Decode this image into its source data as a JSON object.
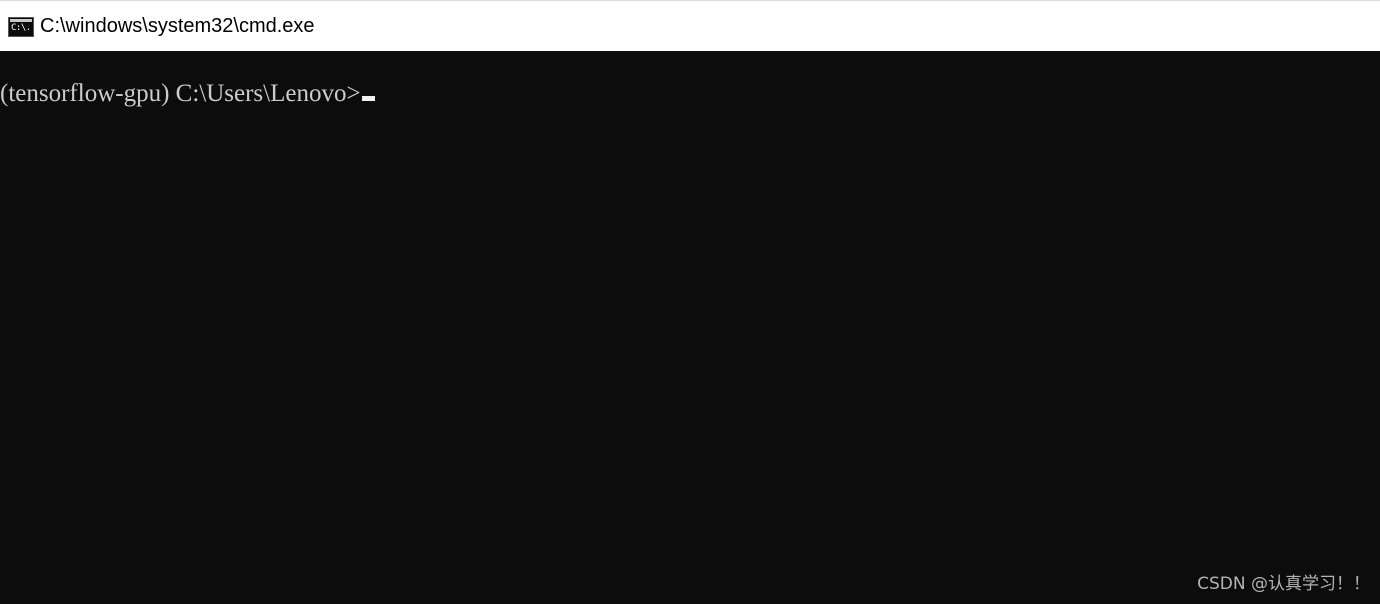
{
  "window": {
    "title": "C:\\windows\\system32\\cmd.exe",
    "icon": "cmd-icon",
    "icon_glyph": "C:\\."
  },
  "console": {
    "prompt": "(tensorflow-gpu) C:\\Users\\Lenovo>",
    "background_color": "#0c0c0c",
    "text_color": "#cccccc"
  },
  "watermark": {
    "text": "CSDN @认真学习！！"
  }
}
